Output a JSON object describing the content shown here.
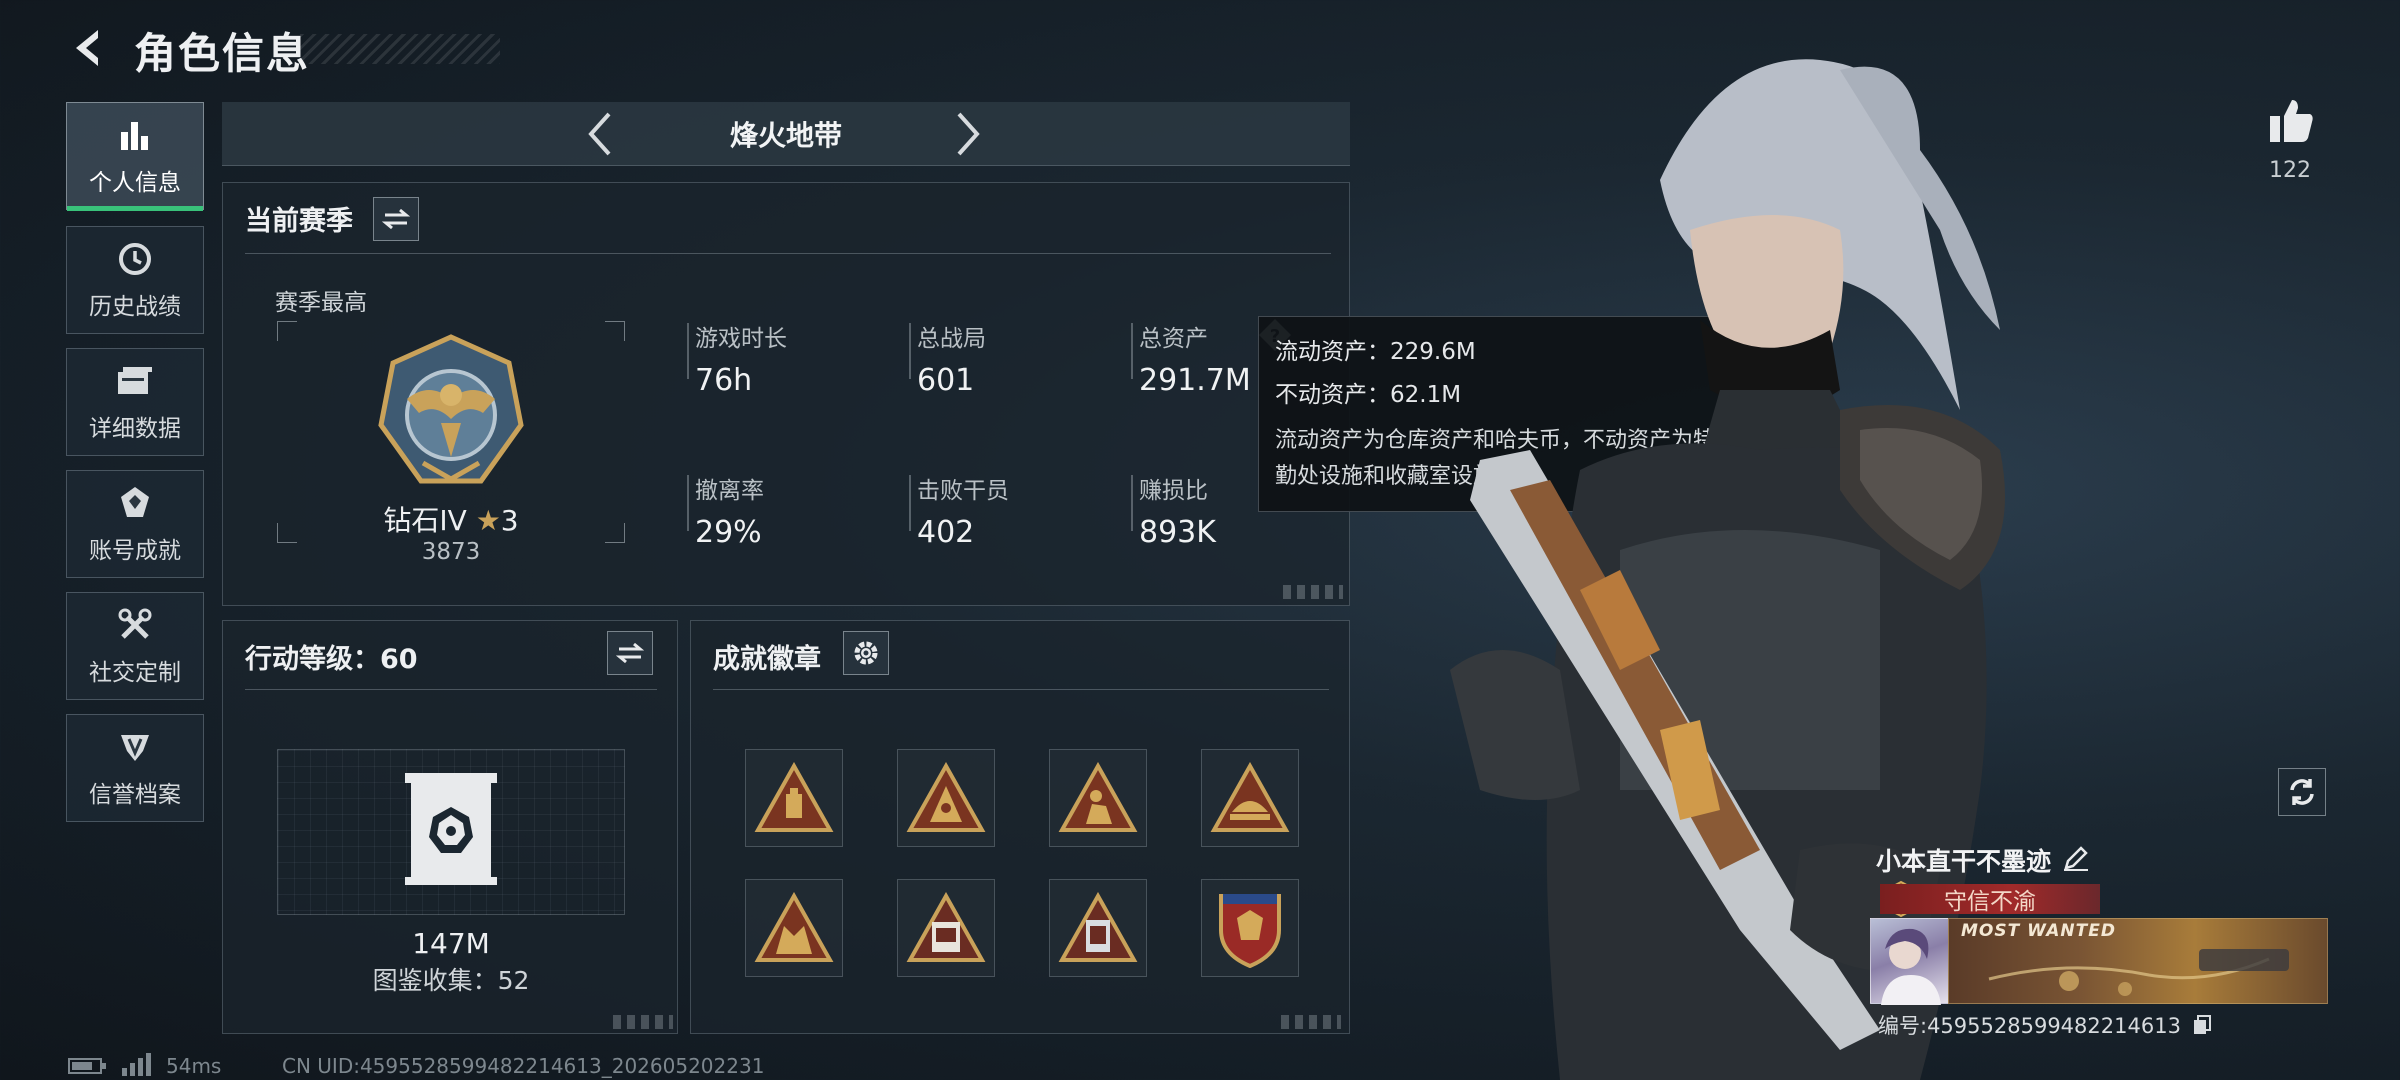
{
  "header": {
    "title": "角色信息"
  },
  "sidebar": {
    "items": [
      {
        "label": "个人信息",
        "icon": "bar-chart-icon",
        "active": true
      },
      {
        "label": "历史战绩",
        "icon": "history-icon",
        "active": false
      },
      {
        "label": "详细数据",
        "icon": "folder-icon",
        "active": false
      },
      {
        "label": "账号成就",
        "icon": "achievement-icon",
        "active": false
      },
      {
        "label": "社交定制",
        "icon": "tools-icon",
        "active": false
      },
      {
        "label": "信誉档案",
        "icon": "shield-gem-icon",
        "active": false
      }
    ]
  },
  "mode": {
    "name": "烽火地带"
  },
  "season": {
    "title": "当前赛季",
    "best_label": "赛季最高",
    "rank_name": "钻石IV",
    "rank_stars": "3",
    "rank_score": "3873",
    "stats": [
      {
        "label": "游戏时长",
        "value": "76h"
      },
      {
        "label": "总战局",
        "value": "601"
      },
      {
        "label": "总资产",
        "value": "291.7M"
      },
      {
        "label": "撤离率",
        "value": "29%"
      },
      {
        "label": "击败干员",
        "value": "402"
      },
      {
        "label": "赚损比",
        "value": "893K"
      }
    ]
  },
  "tooltip": {
    "liquid": "流动资产：229.6M",
    "fixed": "不动资产：62.1M",
    "desc": "流动资产为仓库资产和哈夫币，不动资产为特勤处设施和收藏室设施"
  },
  "action_level": {
    "title": "行动等级：60",
    "value": "147M",
    "collection": "图鉴收集：52"
  },
  "achievements": {
    "title": "成就徽章"
  },
  "profile": {
    "likes": "122",
    "player_name": "小本直干不墨迹",
    "player_title": "守信不渝",
    "card_text": "MOST WANTED",
    "id_text": "编号:4595528599482214613"
  },
  "footer": {
    "ping": "54ms",
    "uid": "CN UID:4595528599482214613_202605202231"
  },
  "colors": {
    "accent": "#39c27a",
    "gold": "#c9a25a",
    "banner": "#a12a2a"
  }
}
